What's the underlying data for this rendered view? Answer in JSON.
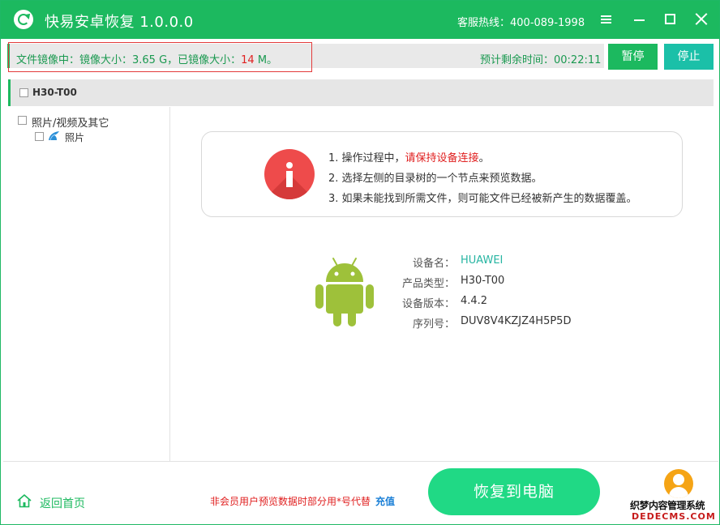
{
  "app": {
    "title": "快易安卓恢复  1.0.0.0",
    "hotline": "客服热线：400-089-1998",
    "accent_color": "#1cb95f"
  },
  "window_controls": [
    "menu-icon",
    "minimize-icon",
    "maximize-icon",
    "close-icon"
  ],
  "progress": {
    "prefix": "文件镜像中：镜像大小：3.65 G，已镜像大小：",
    "imaged_value": "14",
    "suffix": " M。",
    "remaining": "预计剩余时间：00:22:11"
  },
  "actions": {
    "pause_label": "暂停",
    "stop_label": "停止"
  },
  "device_header": {
    "name": "H30-T00"
  },
  "tree": {
    "root_label": "照片/视频及其它",
    "child_label": "照片"
  },
  "info": {
    "line1_prefix": "1. 操作过程中，",
    "line1_highlight": "请保持设备连接",
    "line1_suffix": "。",
    "line2": "2. 选择左侧的目录树的一个节点来预览数据。",
    "line3": "3. 如果未能找到所需文件，则可能文件已经被新产生的数据覆盖。"
  },
  "device_details": {
    "name_label": "设备名：",
    "name_value": "HUAWEI",
    "type_label": "产品类型：",
    "type_value": "H30-T00",
    "version_label": "设备版本：",
    "version_value": "4.4.2",
    "serial_label": "序列号：",
    "serial_value": "DUV8V4KZJZ4H5P5D"
  },
  "footer": {
    "home_label": "返回首页",
    "notice": "非会员用户预览数据时部分用*号代替",
    "recharge_label": "充值",
    "recover_label": "恢复到电脑"
  },
  "watermark": {
    "line1": "织梦内容管理系统",
    "line2": "DEDECMS.COM"
  }
}
